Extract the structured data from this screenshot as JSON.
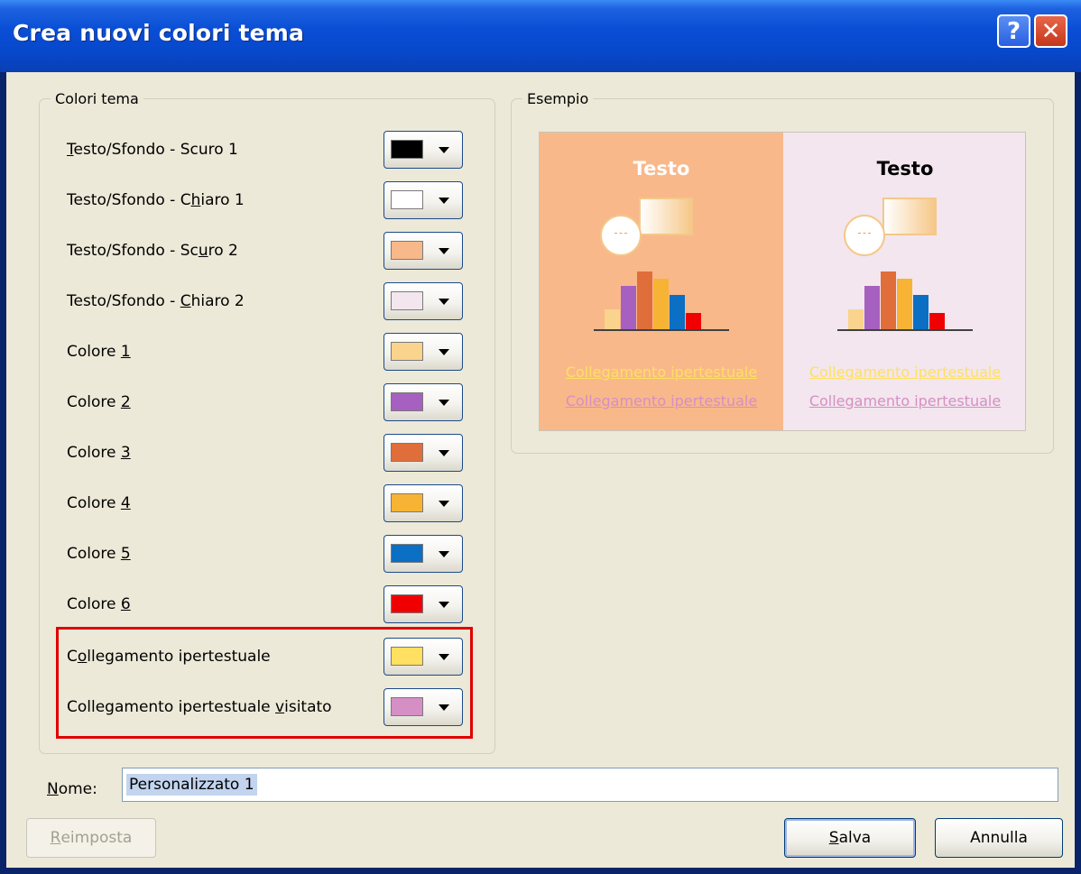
{
  "window": {
    "title": "Crea nuovi colori tema",
    "help_label": "?",
    "close_label": "✕"
  },
  "theme_colors": {
    "group_label": "Colori tema",
    "rows": [
      {
        "pre": "",
        "u": "T",
        "post": "esto/Sfondo - Scuro 1",
        "color": "#000000"
      },
      {
        "pre": "Testo/Sfondo - C",
        "u": "h",
        "post": "iaro 1",
        "color": "#ffffff"
      },
      {
        "pre": "Testo/Sfondo - Sc",
        "u": "u",
        "post": "ro 2",
        "color": "#f9b88a"
      },
      {
        "pre": "Testo/Sfondo - ",
        "u": "C",
        "post": "hiaro 2",
        "color": "#f3e6ee"
      },
      {
        "pre": "Colore ",
        "u": "1",
        "post": "",
        "color": "#fad48c"
      },
      {
        "pre": "Colore ",
        "u": "2",
        "post": "",
        "color": "#a660bf"
      },
      {
        "pre": "Colore ",
        "u": "3",
        "post": "",
        "color": "#e06e3a"
      },
      {
        "pre": "Colore ",
        "u": "4",
        "post": "",
        "color": "#f7b334"
      },
      {
        "pre": "Colore ",
        "u": "5",
        "post": "",
        "color": "#0b6fc4"
      },
      {
        "pre": "Colore ",
        "u": "6",
        "post": "",
        "color": "#f00000"
      },
      {
        "pre": "C",
        "u": "o",
        "post": "llegamento ipertestuale",
        "color": "#ffe060"
      },
      {
        "pre": "Collegamento ipertestuale ",
        "u": "v",
        "post": "isitato",
        "color": "#d58fc4"
      }
    ]
  },
  "preview": {
    "group_label": "Esempio",
    "left": {
      "title": "Testo",
      "title_color": "#ffffff",
      "bg": "#f9b88a"
    },
    "right": {
      "title": "Testo",
      "title_color": "#000000",
      "bg": "#f3e6ee"
    },
    "link_text": "Collegamento ipertestuale",
    "visited_text": "Collegamento ipertestuale",
    "link_color": "#ffe060",
    "visited_color": "#d58fc4",
    "bar_colors": [
      "#fad48c",
      "#a660bf",
      "#e06e3a",
      "#f7b334",
      "#0b6fc4",
      "#f00000"
    ],
    "bar_heights": [
      0.3,
      0.63,
      0.83,
      0.73,
      0.5,
      0.25
    ]
  },
  "name": {
    "pre": "",
    "u": "N",
    "post": "ome:",
    "value": "Personalizzato 1"
  },
  "buttons": {
    "reset": {
      "pre": "",
      "u": "R",
      "post": "eimposta"
    },
    "save": {
      "pre": "",
      "u": "S",
      "post": "alva"
    },
    "cancel": {
      "label": "Annulla"
    }
  }
}
